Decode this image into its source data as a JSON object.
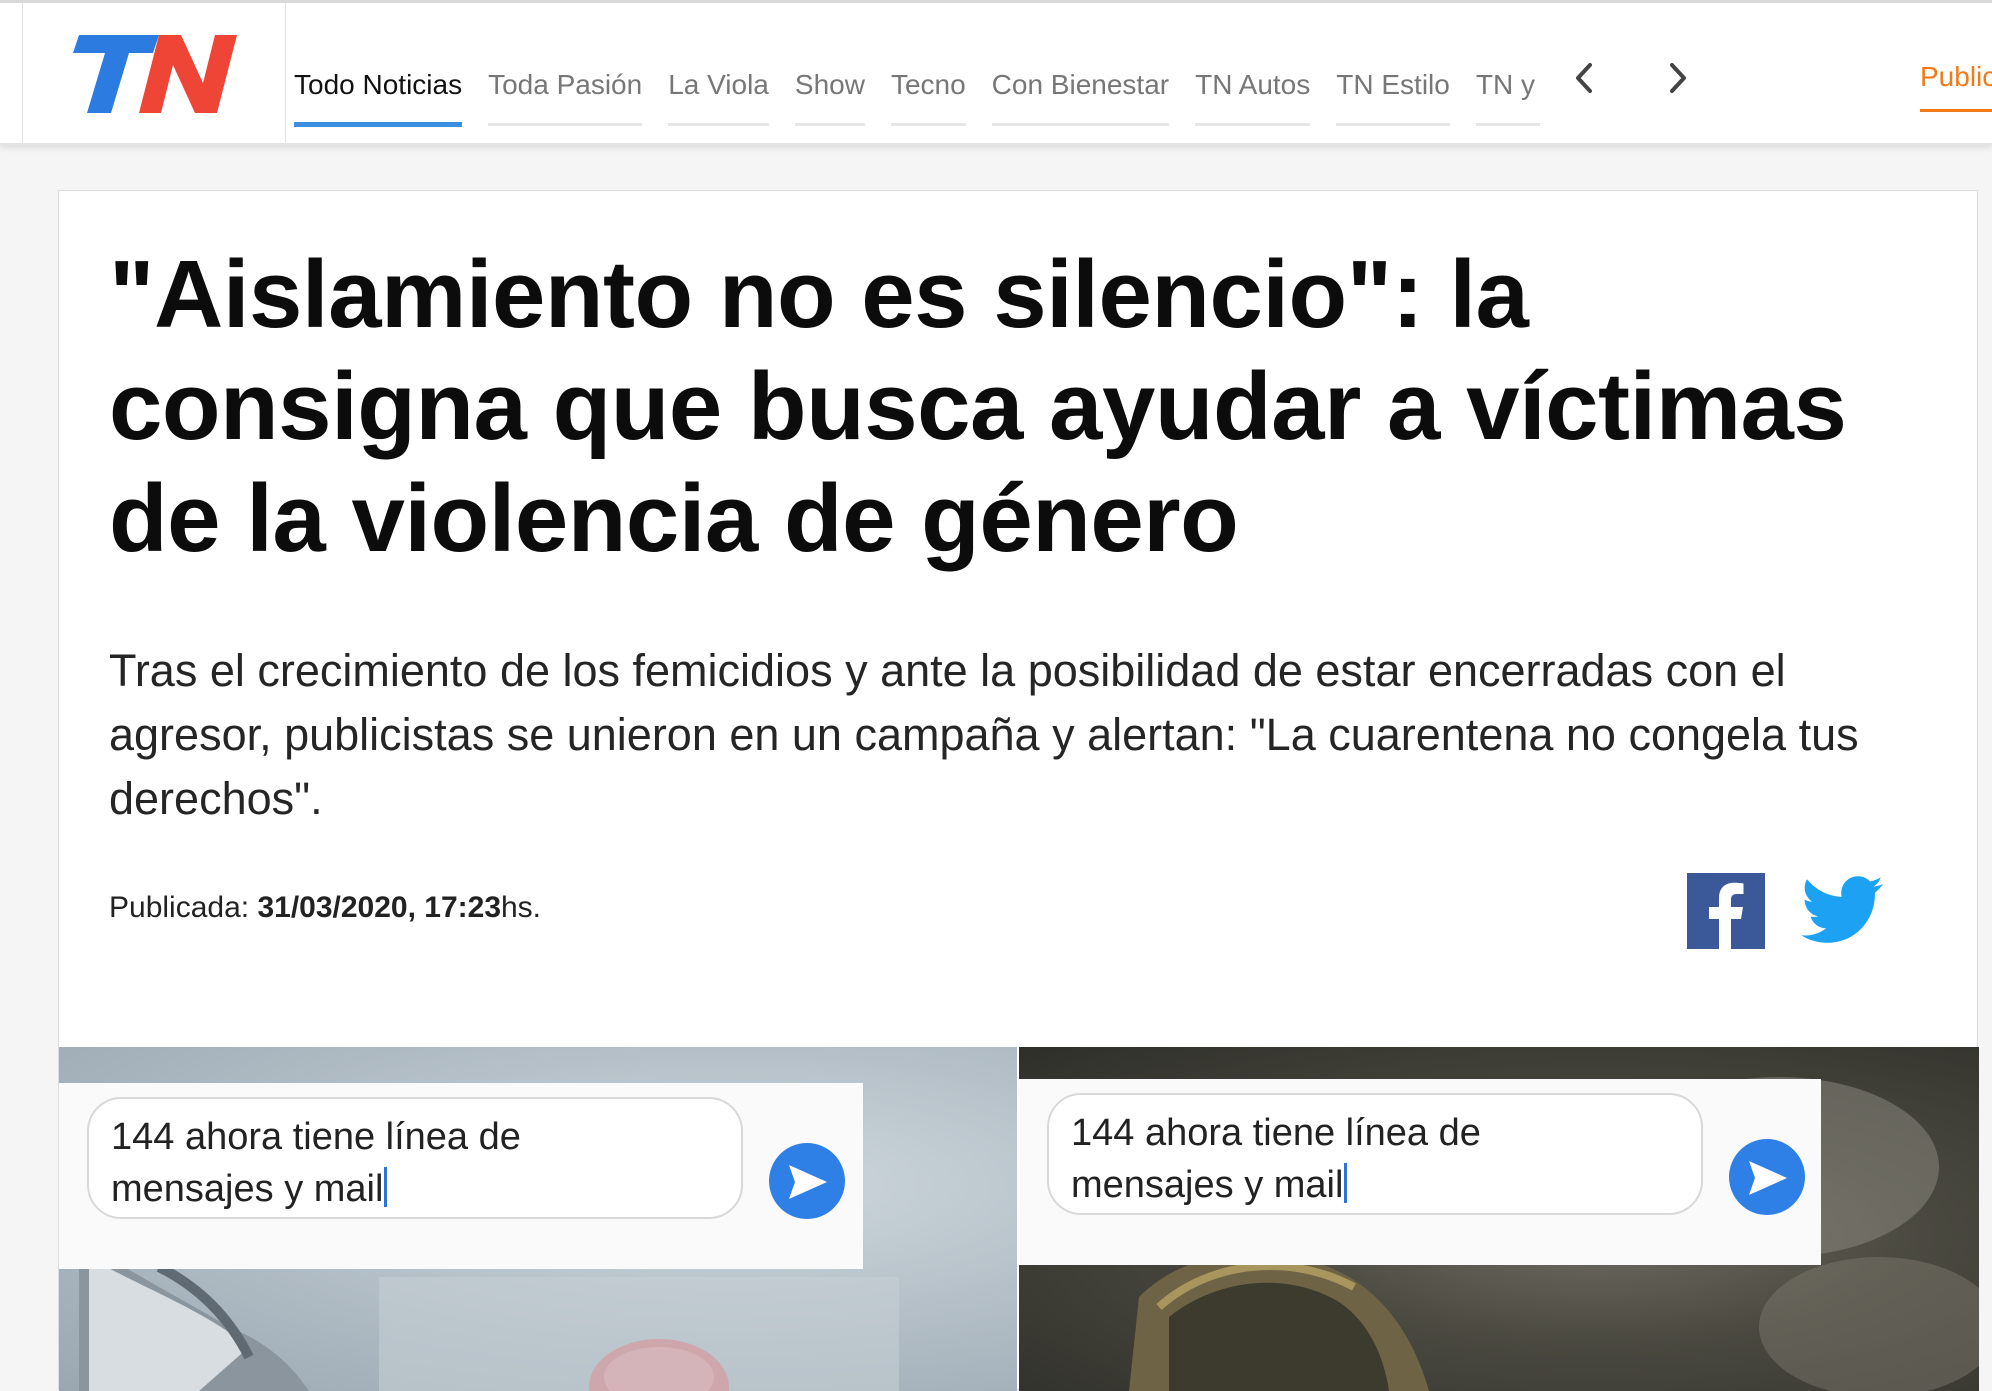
{
  "brand": {
    "logo_text": "TN",
    "accent": "#3b8fe0",
    "logo_blue": "#2b7be0",
    "logo_red": "#ef4536"
  },
  "nav": {
    "items": [
      {
        "label": "Todo Noticias",
        "active": true
      },
      {
        "label": "Toda Pasión",
        "active": false
      },
      {
        "label": "La Viola",
        "active": false
      },
      {
        "label": "Show",
        "active": false
      },
      {
        "label": "Tecno",
        "active": false
      },
      {
        "label": "Con Bienestar",
        "active": false
      },
      {
        "label": "TN Autos",
        "active": false
      },
      {
        "label": "TN Estilo",
        "active": false
      },
      {
        "label": "TN y la gente",
        "active": false
      }
    ],
    "prev_icon": "chevron-left-icon",
    "next_icon": "chevron-right-icon",
    "publish_label": "Publicá",
    "publish_color": "#f27a1a"
  },
  "article": {
    "headline": "\"Aislamiento no es silencio\": la consigna que busca ayudar a víctimas de la violencia de género",
    "summary": "Tras el crecimiento de los femicidios y ante la posibilidad de estar encerradas con el agresor, publicistas se unieron en un campaña y alertan: \"La cuarentena no congela tus derechos\".",
    "published_label": "Publicada:",
    "published_datetime": "31/03/2020, 17:23",
    "published_suffix": "hs.",
    "share": {
      "facebook_icon": "facebook-icon",
      "twitter_icon": "twitter-icon",
      "facebook_color": "#3b5998",
      "twitter_color": "#1da1f2"
    }
  },
  "media": {
    "left": {
      "message_line1": "144 ahora tiene línea de",
      "message_line2": "mensajes y mail"
    },
    "right": {
      "message_line1": "144 ahora tiene línea de",
      "message_line2": "mensajes y mail"
    }
  }
}
